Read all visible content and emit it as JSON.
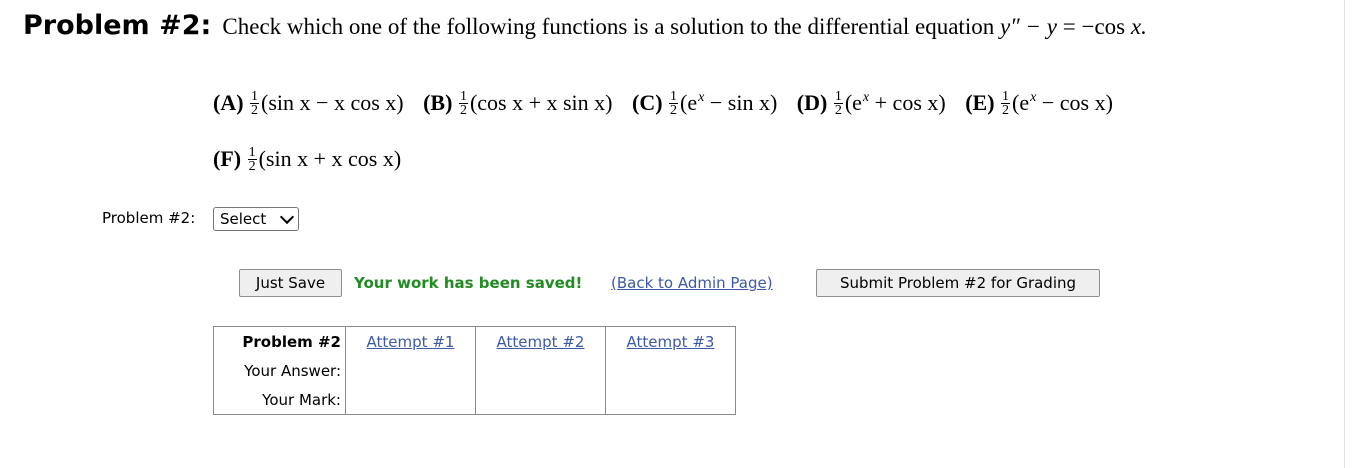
{
  "problem": {
    "title": "Problem #2:",
    "text": "Check which one of the following functions is a solution to the differential equation",
    "equation": {
      "lhs": "y″ − y",
      "eq": "=",
      "rhs_cos": "−cos",
      "rhs_var": "x."
    }
  },
  "choices": [
    {
      "label": "(A)",
      "num": "1",
      "den": "2",
      "expr": "(sin x − x cos x)"
    },
    {
      "label": "(B)",
      "num": "1",
      "den": "2",
      "expr": "(cos x + x sin x)"
    },
    {
      "label": "(C)",
      "num": "1",
      "den": "2",
      "pre": "(e",
      "sup": "x",
      "post": " − sin x)"
    },
    {
      "label": "(D)",
      "num": "1",
      "den": "2",
      "pre": "(e",
      "sup": "x",
      "post": " + cos x)"
    },
    {
      "label": "(E)",
      "num": "1",
      "den": "2",
      "pre": "(e",
      "sup": "x",
      "post": " − cos x)"
    },
    {
      "label": "(F)",
      "num": "1",
      "den": "2",
      "expr": "(sin x + x cos x)"
    }
  ],
  "answer": {
    "label": "Problem #2:",
    "select_value": "Select"
  },
  "actions": {
    "save_label": "Just Save",
    "saved_message": "Your work has been saved!",
    "admin_link": "(Back to Admin Page)",
    "submit_label": "Submit Problem #2 for Grading"
  },
  "attempts_table": {
    "header": "Problem #2",
    "columns": [
      "Attempt #1",
      "Attempt #2",
      "Attempt #3"
    ],
    "row_labels": [
      "Your Answer:",
      "Your Mark:"
    ]
  }
}
